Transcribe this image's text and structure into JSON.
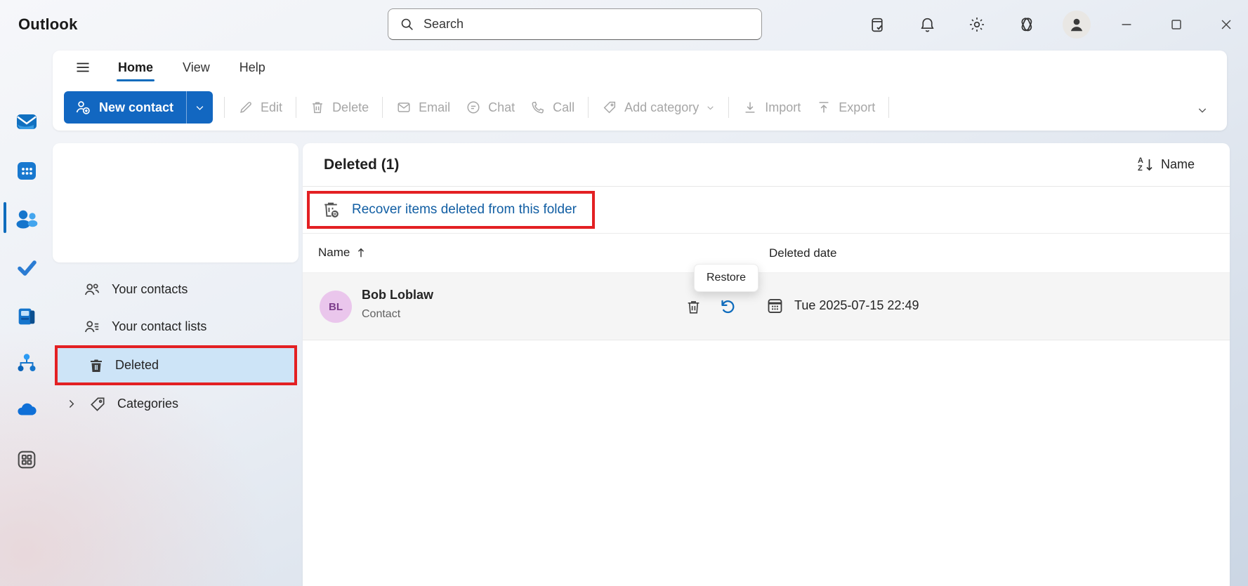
{
  "titlebar": {
    "app_title": "Outlook",
    "search_placeholder": "Search",
    "icon_names": [
      "my-day",
      "notifications",
      "settings",
      "copilot",
      "account",
      "minimize",
      "maximize",
      "close"
    ]
  },
  "ribbon": {
    "tabs": [
      {
        "label": "Home",
        "active": true
      },
      {
        "label": "View",
        "active": false
      },
      {
        "label": "Help",
        "active": false
      }
    ],
    "new_contact_label": "New contact",
    "actions": [
      {
        "label": "Edit",
        "enabled": false
      },
      {
        "label": "Delete",
        "enabled": false
      },
      {
        "label": "Email",
        "enabled": false
      },
      {
        "label": "Chat",
        "enabled": false
      },
      {
        "label": "Call",
        "enabled": false
      },
      {
        "label": "Add category",
        "enabled": false,
        "has_dropdown": true
      },
      {
        "label": "Import",
        "enabled": false
      },
      {
        "label": "Export",
        "enabled": false
      }
    ]
  },
  "rail": {
    "items": [
      "mail",
      "calendar",
      "people",
      "to-do",
      "fax",
      "org-explorer",
      "onedrive",
      "more-apps"
    ],
    "selected": "people"
  },
  "sidebar": {
    "items": [
      {
        "label": "Your contacts",
        "selected": false
      },
      {
        "label": "Your contact lists",
        "selected": false
      },
      {
        "label": "Deleted",
        "selected": true,
        "annotated": true
      },
      {
        "label": "Categories",
        "expandable": true
      }
    ]
  },
  "main": {
    "title": "Deleted (1)",
    "sort": {
      "label": "Name",
      "icon_letters": {
        "top": "A",
        "bottom": "Z"
      }
    },
    "recover_link": "Recover items deleted from this folder",
    "recover_link_annotated": true,
    "columns": {
      "name": "Name",
      "deleted_date": "Deleted date"
    },
    "tooltip": "Restore",
    "rows": [
      {
        "initials": "BL",
        "name": "Bob Loblaw",
        "type": "Contact",
        "deleted_date": "Tue 2025-07-15 22:49"
      }
    ]
  },
  "colors": {
    "accent": "#0f6cbd",
    "link": "#115ea3",
    "annotation_red": "#e32023",
    "selected_item_bg": "#cde4f7",
    "row_bg": "#f5f5f5",
    "avatar_bg": "#eac6ec",
    "avatar_text": "#7d3d8c"
  }
}
